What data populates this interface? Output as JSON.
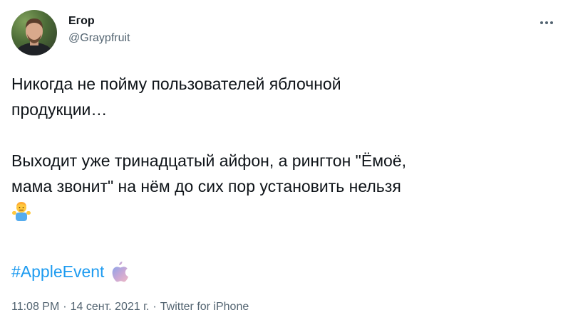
{
  "author": {
    "display_name": "Егор",
    "handle": "@Graypfruit"
  },
  "tweet": {
    "paragraph1_line1": "Никогда не пойму пользователей яблочной",
    "paragraph1_line2": "продукции…",
    "paragraph2_line1": "Выходит уже тринадцатый айфон, а рингтон \"Ёмоё,",
    "paragraph2_line2": "мама звонит\" на нём до сих пор установить нельзя",
    "emoji": "man-shrugging-emoji",
    "hashtag": "#AppleEvent",
    "hashtag_icon": "apple-logo-icon"
  },
  "meta": {
    "time": "11:08 PM",
    "separator": "·",
    "date": "14 сент. 2021 г.",
    "source": "Twitter for iPhone"
  },
  "colors": {
    "text": "#0f1419",
    "secondary": "#536471",
    "link": "#1d9bf0",
    "background": "#ffffff"
  }
}
